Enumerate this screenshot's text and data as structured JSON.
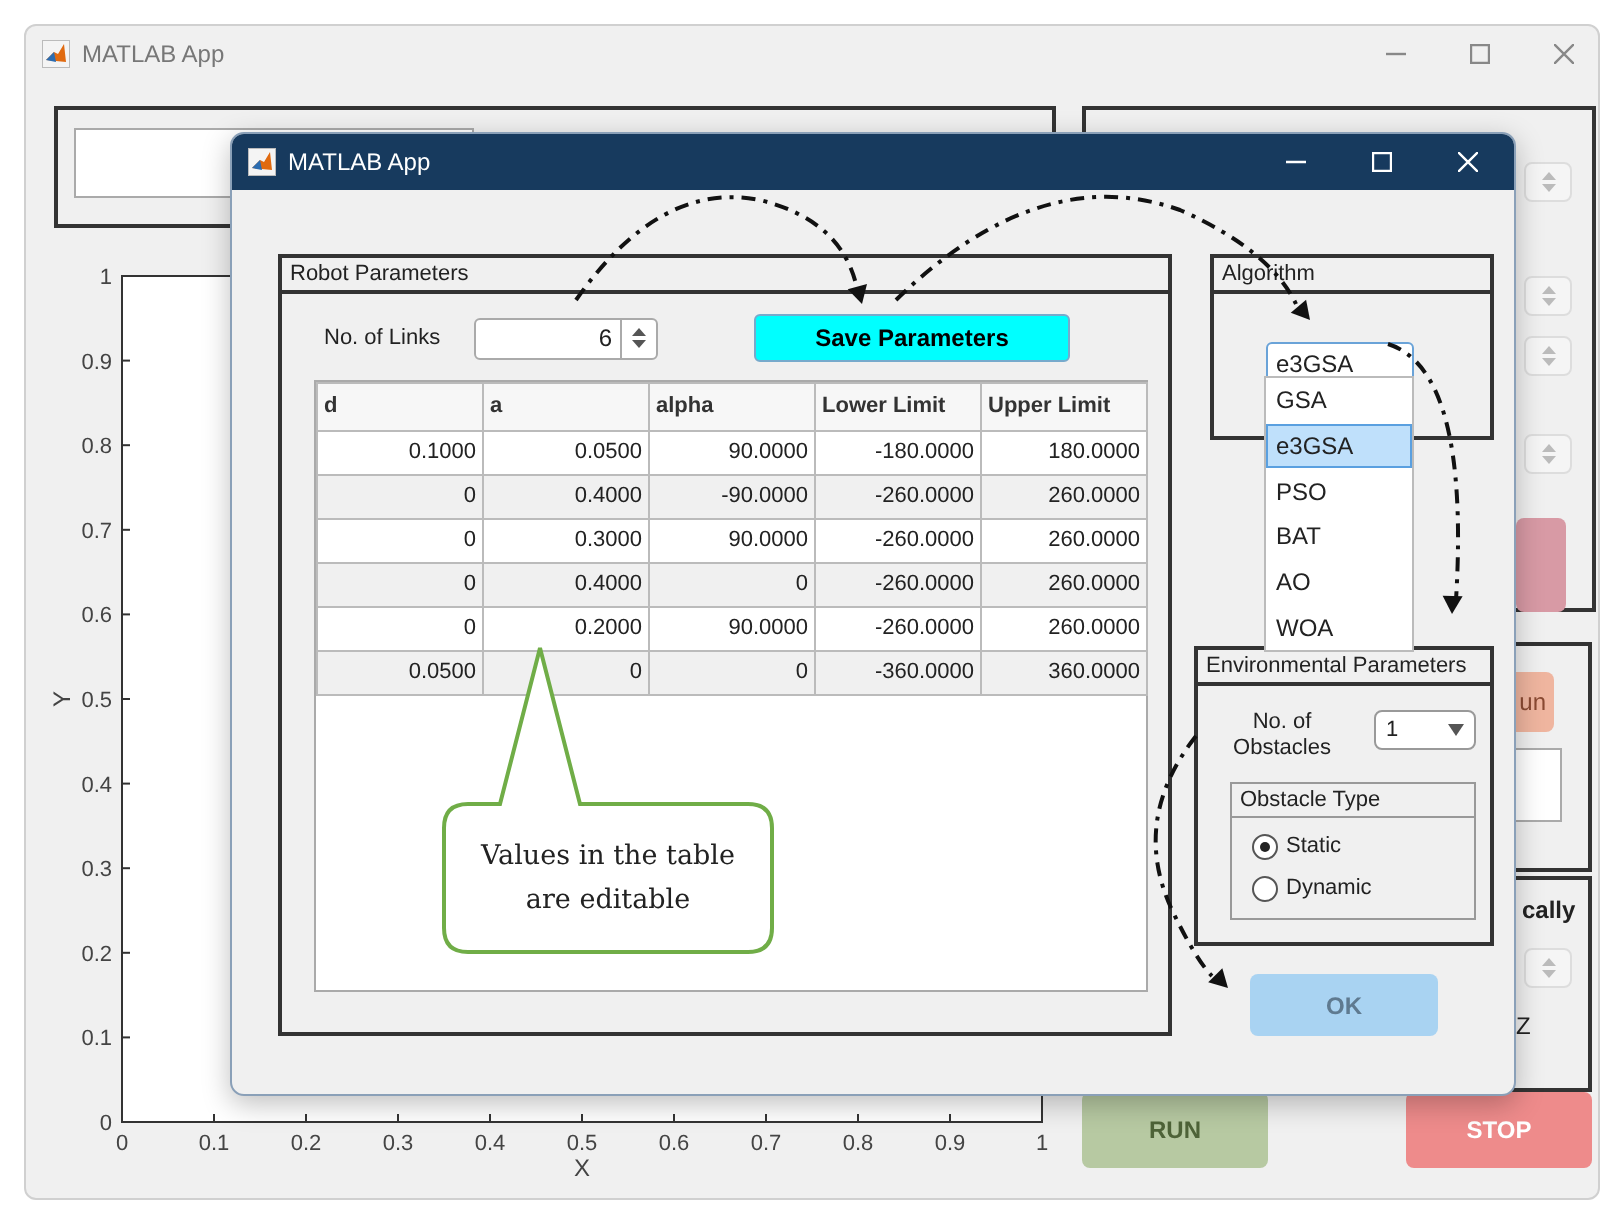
{
  "background_window": {
    "title": "MATLAB App",
    "axes": {
      "xlabel": "X",
      "ylabel": "Y",
      "xticks": [
        "0",
        "0.1",
        "0.2",
        "0.3",
        "0.4",
        "0.5",
        "0.6",
        "0.7",
        "0.8",
        "0.9",
        "1"
      ],
      "yticks": [
        "1",
        "0.9",
        "0.8",
        "0.7",
        "0.6",
        "0.5",
        "0.4",
        "0.3",
        "0.2",
        "0.1",
        "0"
      ]
    },
    "button_fragment": "un",
    "label_fragment": "cally",
    "unit_fragment": "Z",
    "buttons": [
      {
        "label": "RUN",
        "kind": "run"
      },
      {
        "label": "STOP",
        "kind": "stop"
      }
    ]
  },
  "dialog": {
    "title": "MATLAB App",
    "robot_parameters": {
      "title": "Robot Parameters",
      "links_label": "No. of Links",
      "links_value": "6",
      "save_button": "Save Parameters",
      "table": {
        "columns": [
          "d",
          "a",
          "alpha",
          "Lower Limit",
          "Upper Limit"
        ],
        "rows": [
          [
            "0.1000",
            "0.0500",
            "90.0000",
            "-180.0000",
            "180.0000"
          ],
          [
            "0",
            "0.4000",
            "-90.0000",
            "-260.0000",
            "260.0000"
          ],
          [
            "0",
            "0.3000",
            "90.0000",
            "-260.0000",
            "260.0000"
          ],
          [
            "0",
            "0.4000",
            "0",
            "-260.0000",
            "260.0000"
          ],
          [
            "0",
            "0.2000",
            "90.0000",
            "-260.0000",
            "260.0000"
          ],
          [
            "0.0500",
            "0",
            "0",
            "-360.0000",
            "360.0000"
          ]
        ]
      }
    },
    "algorithm": {
      "title": "Algorithm",
      "value": "e3GSA",
      "expanded": true,
      "options": [
        {
          "label": "GSA",
          "selected": false
        },
        {
          "label": "e3GSA",
          "selected": true
        },
        {
          "label": "PSO",
          "selected": false
        },
        {
          "label": "BAT",
          "selected": false
        },
        {
          "label": "AO",
          "selected": false
        },
        {
          "label": "WOA",
          "selected": false
        }
      ]
    },
    "environment": {
      "title": "Environmental Parameters",
      "obstacles_label": "No. of Obstacles",
      "obstacles_value": "1",
      "obstacle_type": {
        "title": "Obstacle Type",
        "options": [
          {
            "label": "Static",
            "selected": true
          },
          {
            "label": "Dynamic",
            "selected": false
          }
        ]
      }
    },
    "ok_button": {
      "label": "OK",
      "disabled": true
    }
  },
  "callout": "Values in the table are editable"
}
